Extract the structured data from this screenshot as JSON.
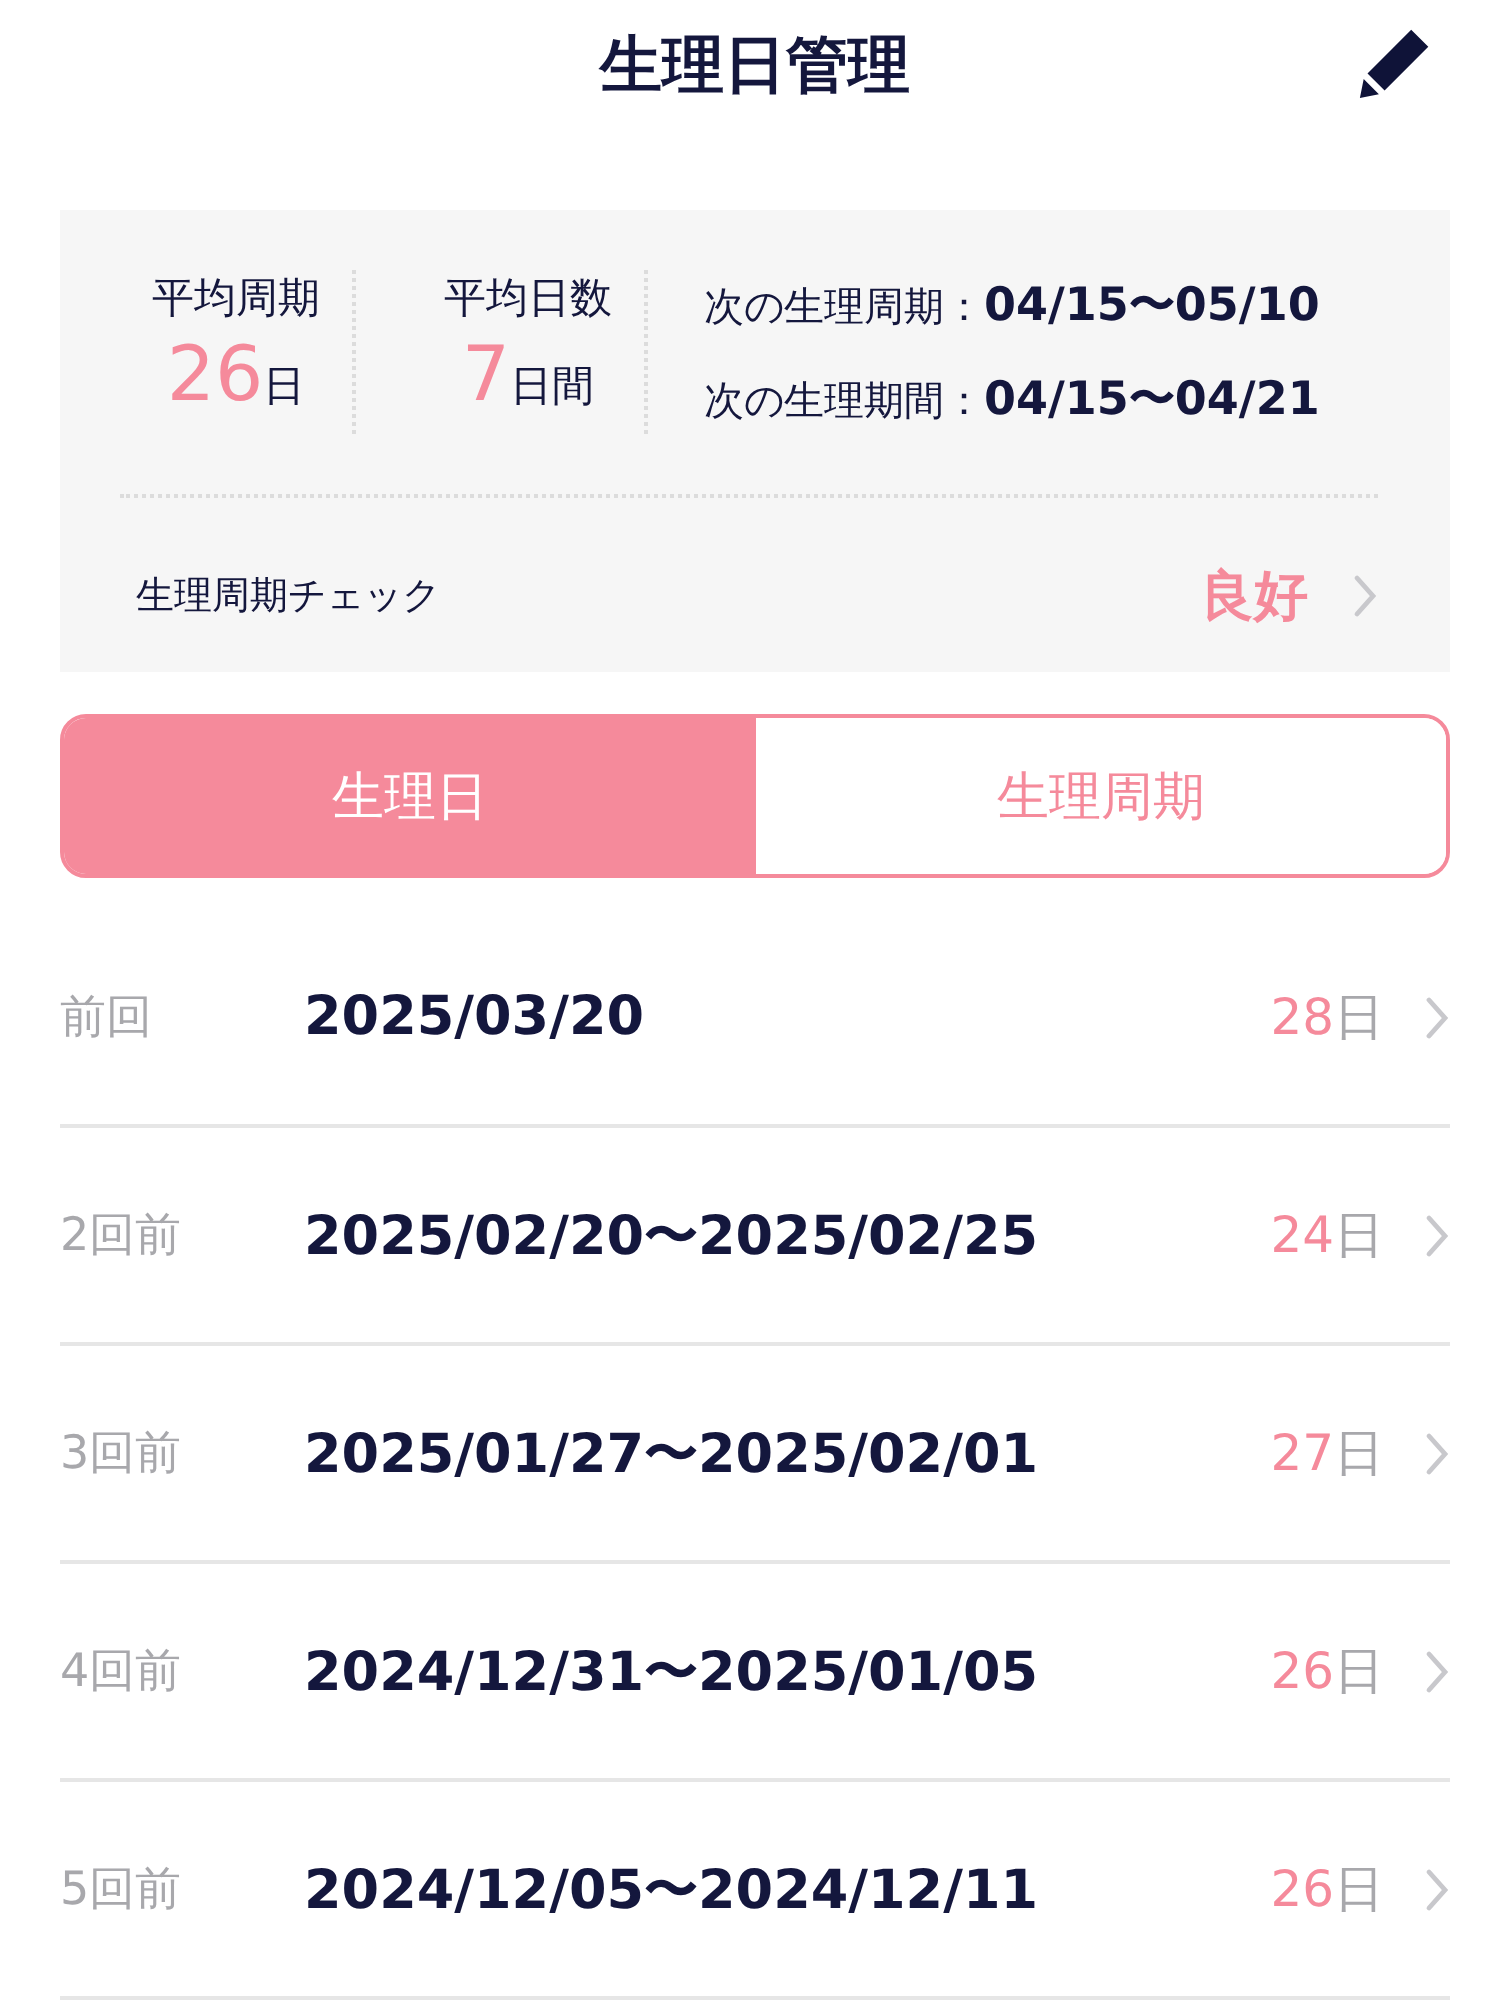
{
  "header": {
    "title": "生理日管理"
  },
  "summary": {
    "stats": [
      {
        "label": "平均周期",
        "value": "26",
        "unit": "日"
      },
      {
        "label": "平均日数",
        "value": "7",
        "unit": "日間"
      }
    ],
    "next": [
      {
        "label": "次の生理周期：",
        "value": "04/15〜05/10"
      },
      {
        "label": "次の生理期間：",
        "value": "04/15〜04/21"
      }
    ],
    "check": {
      "label": "生理周期チェック",
      "value": "良好"
    }
  },
  "tabs": [
    {
      "label": "生理日",
      "selected": true
    },
    {
      "label": "生理周期",
      "selected": false
    }
  ],
  "records": [
    {
      "label": "前回",
      "dates": "2025/03/20",
      "days": "28",
      "unit": "日"
    },
    {
      "label": "2回前",
      "dates": "2025/02/20〜2025/02/25",
      "days": "24",
      "unit": "日"
    },
    {
      "label": "3回前",
      "dates": "2025/01/27〜2025/02/01",
      "days": "27",
      "unit": "日"
    },
    {
      "label": "4回前",
      "dates": "2024/12/31〜2025/01/05",
      "days": "26",
      "unit": "日"
    },
    {
      "label": "5回前",
      "dates": "2024/12/05〜2024/12/11",
      "days": "26",
      "unit": "日"
    }
  ]
}
